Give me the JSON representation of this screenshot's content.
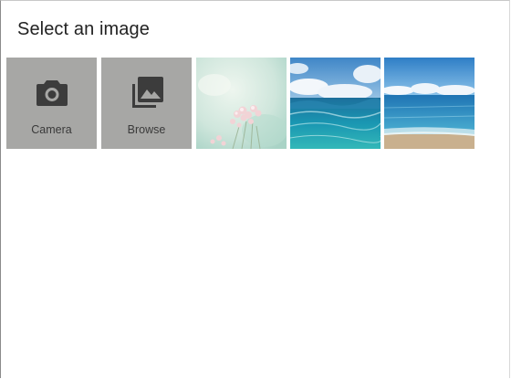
{
  "dialog": {
    "title": "Select an image"
  },
  "actions": [
    {
      "label": "Camera",
      "icon": "camera-icon"
    },
    {
      "label": "Browse",
      "icon": "photo-library-icon"
    }
  ],
  "photos": [
    {
      "subject": "pink flowers"
    },
    {
      "subject": "ocean waves under clouds"
    },
    {
      "subject": "beach shoreline with sky"
    }
  ],
  "colors": {
    "tile_background": "#a7a7a5",
    "icon": "#3c3c3c",
    "title_text": "#222222"
  }
}
